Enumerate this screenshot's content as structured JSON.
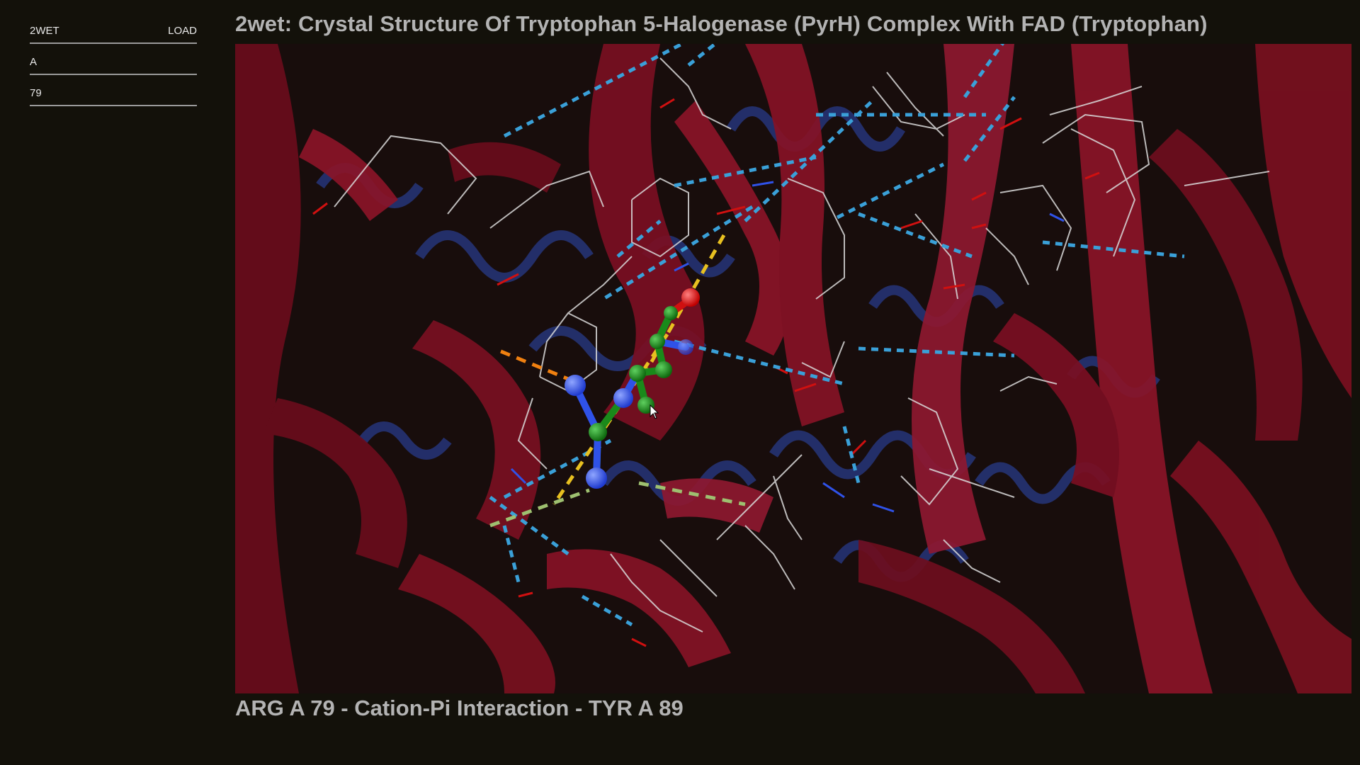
{
  "sidebar": {
    "pdb_id": "2WET",
    "load_label": "LOAD",
    "chain": "A",
    "residue": "79"
  },
  "title": "2wet: Crystal Structure Of Tryptophan 5-Halogenase (PyrH) Complex With FAD (Tryptophan)",
  "caption": "ARG A 79 - Cation-Pi Interaction - TYR A 89",
  "colors": {
    "background": "#13110a",
    "helix_red": "#7a0f22",
    "helix_blue": "#2a3a7a",
    "carbon": "#1a8a1a",
    "nitrogen": "#2f52e8",
    "oxygen": "#e81010",
    "hbond": "#3aa0d8",
    "cation_pi": "#e8c020",
    "salt_bridge": "#f08010",
    "pi_stack": "#9ec070"
  },
  "icons": {
    "cursor": "mouse-pointer-icon"
  }
}
